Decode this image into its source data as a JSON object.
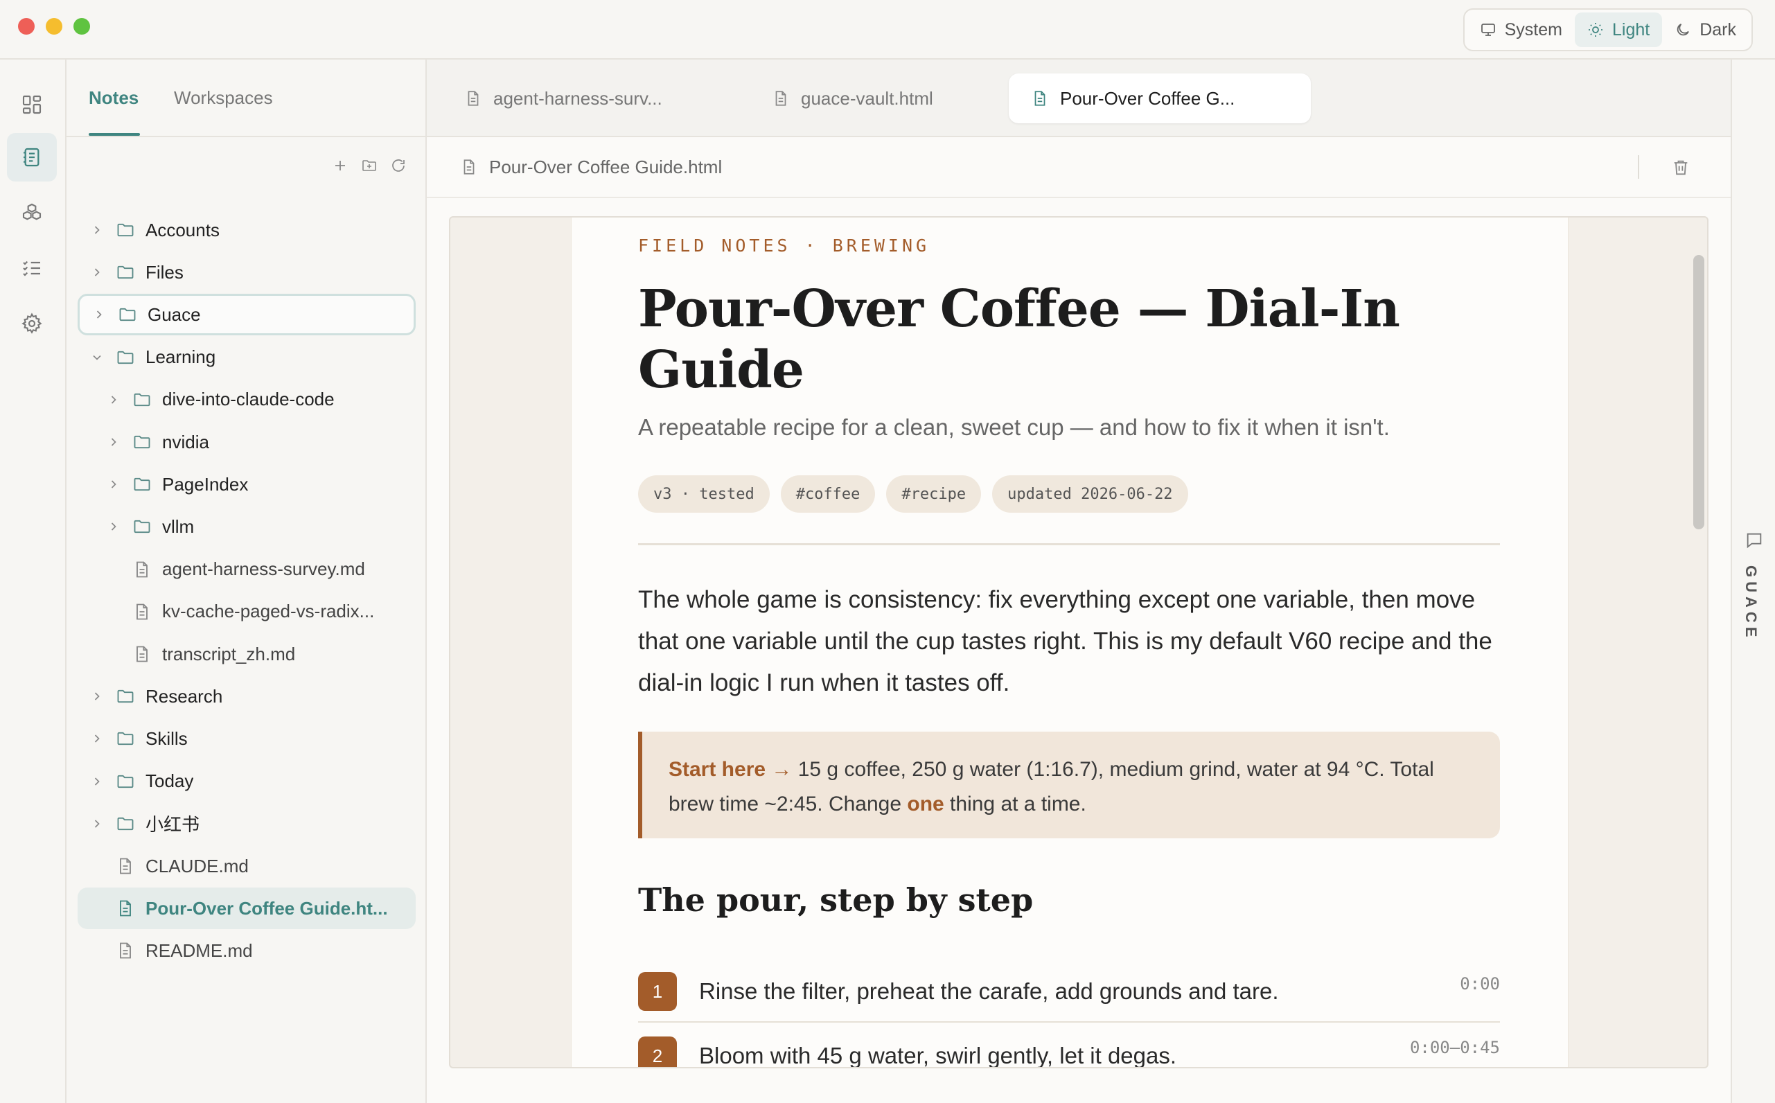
{
  "theme": {
    "options": [
      {
        "label": "System",
        "icon": "monitor-icon"
      },
      {
        "label": "Light",
        "icon": "sun-icon"
      },
      {
        "label": "Dark",
        "icon": "moon-icon"
      }
    ],
    "active": "Light"
  },
  "rail": {
    "items": [
      {
        "icon": "dashboard-icon"
      },
      {
        "icon": "notes-icon"
      },
      {
        "icon": "cubes-icon"
      },
      {
        "icon": "checklist-icon"
      },
      {
        "icon": "settings-icon"
      }
    ],
    "active_index": 1
  },
  "sidebar": {
    "tabs": [
      "Notes",
      "Workspaces"
    ],
    "active_tab": "Notes",
    "actions": [
      "plus-icon",
      "new-folder-icon",
      "refresh-icon"
    ],
    "tree": [
      {
        "label": "Accounts",
        "type": "folder",
        "expanded": false,
        "depth": 0
      },
      {
        "label": "Files",
        "type": "folder",
        "expanded": false,
        "depth": 0
      },
      {
        "label": "Guace",
        "type": "folder",
        "expanded": false,
        "depth": 0,
        "focused": true
      },
      {
        "label": "Learning",
        "type": "folder",
        "expanded": true,
        "depth": 0
      },
      {
        "label": "dive-into-claude-code",
        "type": "folder",
        "expanded": false,
        "depth": 1
      },
      {
        "label": "nvidia",
        "type": "folder",
        "expanded": false,
        "depth": 1
      },
      {
        "label": "PageIndex",
        "type": "folder",
        "expanded": false,
        "depth": 1
      },
      {
        "label": "vllm",
        "type": "folder",
        "expanded": false,
        "depth": 1
      },
      {
        "label": "agent-harness-survey.md",
        "type": "file",
        "depth": 1
      },
      {
        "label": "kv-cache-paged-vs-radix...",
        "type": "file",
        "depth": 1
      },
      {
        "label": "transcript_zh.md",
        "type": "file",
        "depth": 1
      },
      {
        "label": "Research",
        "type": "folder",
        "expanded": false,
        "depth": 0
      },
      {
        "label": "Skills",
        "type": "folder",
        "expanded": false,
        "depth": 0
      },
      {
        "label": "Today",
        "type": "folder",
        "expanded": false,
        "depth": 0
      },
      {
        "label": "小红书",
        "type": "folder",
        "expanded": false,
        "depth": 0
      },
      {
        "label": "CLAUDE.md",
        "type": "file",
        "depth": 0
      },
      {
        "label": "Pour-Over Coffee Guide.ht...",
        "type": "file",
        "depth": 0,
        "selected": true
      },
      {
        "label": "README.md",
        "type": "file",
        "depth": 0
      }
    ]
  },
  "editor": {
    "tabs": [
      {
        "label": "agent-harness-surv...",
        "active": false
      },
      {
        "label": "guace-vault.html",
        "active": false
      },
      {
        "label": "Pour-Over Coffee G...",
        "active": true
      }
    ],
    "path": "Pour-Over Coffee Guide.html"
  },
  "document": {
    "eyebrow": "FIELD NOTES · BREWING",
    "title": "Pour-Over Coffee — Dial-In Guide",
    "subtitle": "A repeatable recipe for a clean, sweet cup — and how to fix it when it isn't.",
    "chips": [
      "v3 · tested",
      "#coffee",
      "#recipe",
      "updated 2026-06-22"
    ],
    "intro": "The whole game is consistency: fix everything except one variable, then move that one variable until the cup tastes right. This is my default V60 recipe and the dial-in logic I run when it tastes off.",
    "callout": {
      "lead": "Start here →",
      "text_before": " 15 g coffee, 250 g water (1:16.7), medium grind, water at 94 °C. Total brew time ~2:45. Change ",
      "emphasis": "one",
      "text_after": " thing at a time."
    },
    "section_title": "The pour, step by step",
    "steps": [
      {
        "num": "1",
        "text": "Rinse the filter, preheat the carafe, add grounds and tare.",
        "time": "0:00"
      },
      {
        "num": "2",
        "text": "Bloom with 45 g water, swirl gently, let it degas.",
        "time": "0:00–0:45"
      }
    ]
  },
  "right_rail": {
    "label": "GUACE",
    "icon": "chat-icon"
  }
}
